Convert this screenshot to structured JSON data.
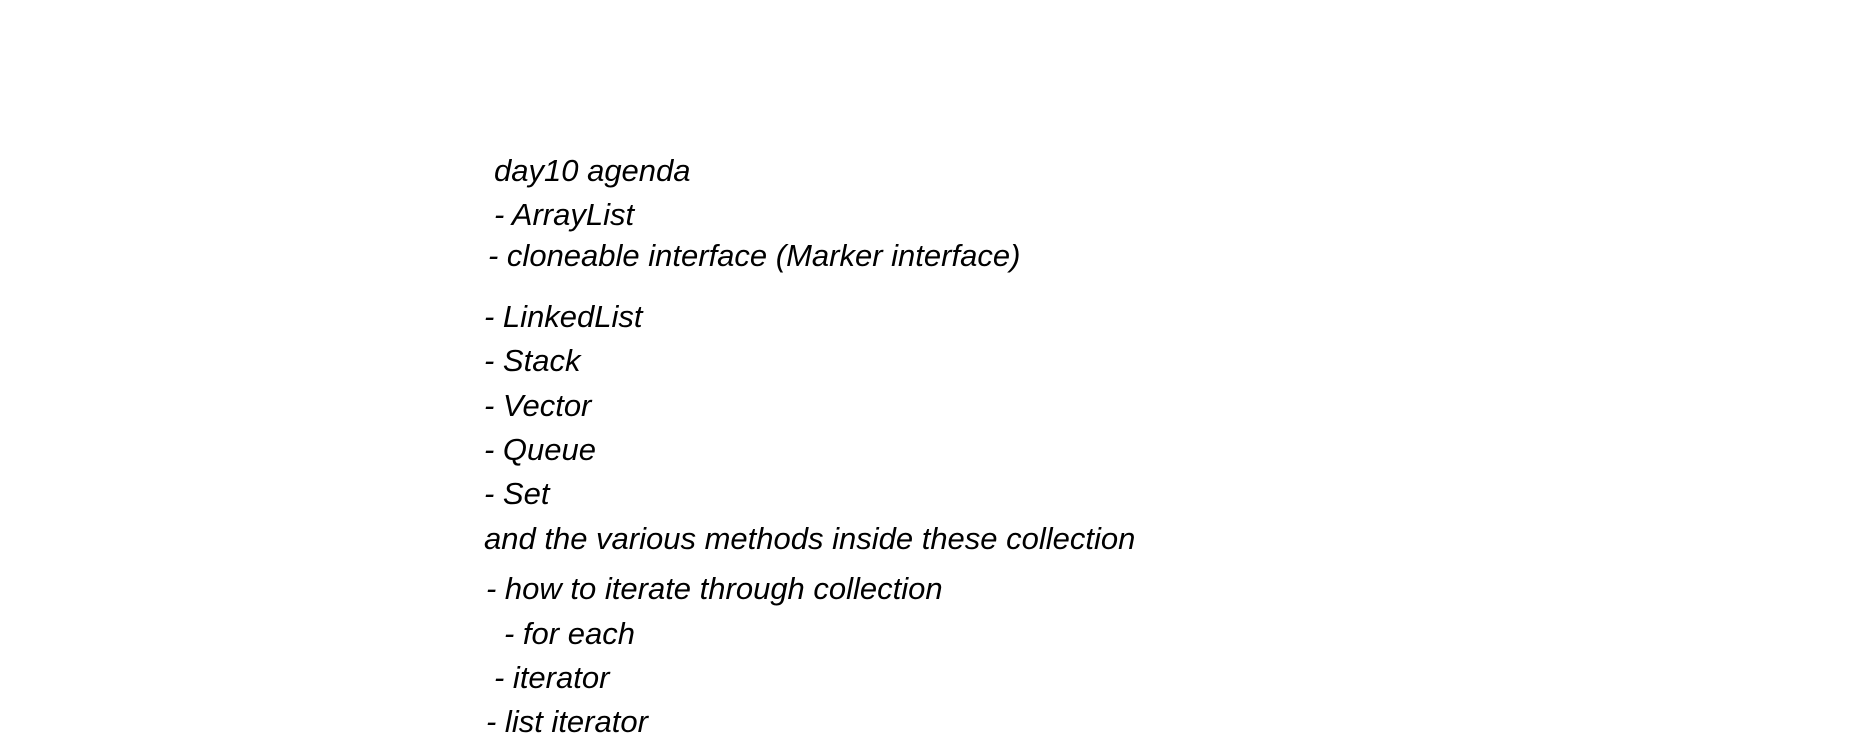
{
  "note": {
    "title": "day10 agenda",
    "lines": [
      "- ArrayList",
      "- cloneable interface (Marker interface)",
      "- LinkedList",
      "- Stack",
      "- Vector",
      "- Queue",
      "- Set",
      "and the various methods inside these collection",
      "- how to iterate through collection",
      "- for each",
      "- iterator",
      "- list iterator"
    ]
  }
}
